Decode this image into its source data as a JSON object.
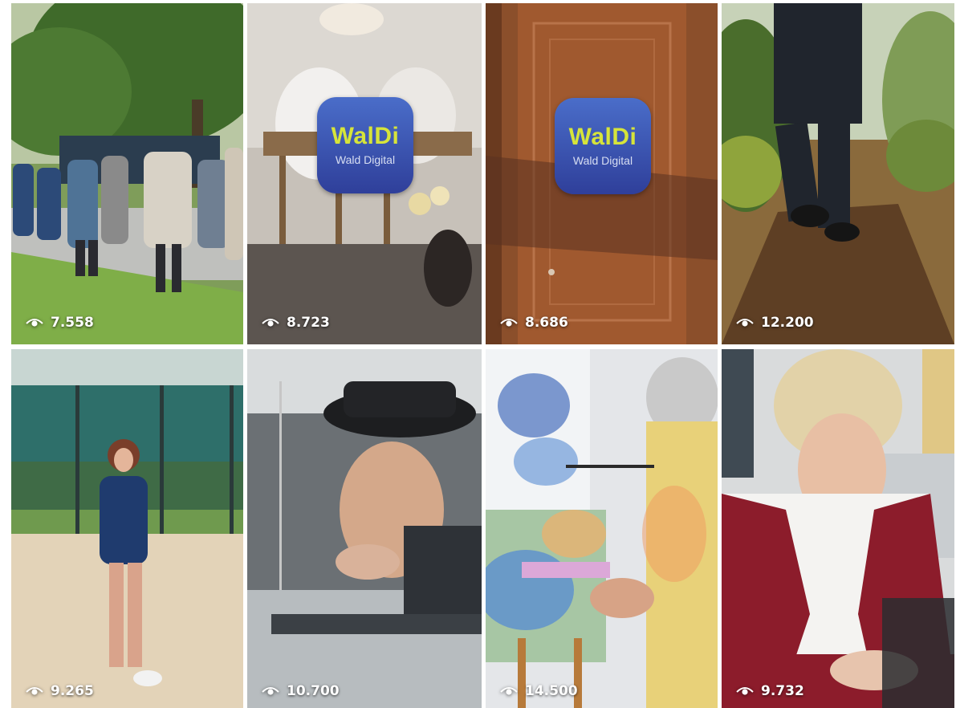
{
  "grid": {
    "tiles": [
      {
        "views": "7.558",
        "scene": "group of people walking on a path under a large tree",
        "logo": null
      },
      {
        "views": "8.723",
        "scene": "blurred people at a dining table, vase with flowers",
        "logo": {
          "word": "WalDi",
          "sub": "Wald Digital"
        }
      },
      {
        "views": "8.686",
        "scene": "wooden door in warm light",
        "logo": {
          "word": "WalDi",
          "sub": "Wald Digital"
        }
      },
      {
        "views": "12.200",
        "scene": "person walking on a forest path",
        "logo": null
      },
      {
        "views": "9.265",
        "scene": "woman in blue jacket walking on sand near a sports field fence",
        "logo": null
      },
      {
        "views": "10.700",
        "scene": "man in hat looking out of car window",
        "logo": null
      },
      {
        "views": "14.500",
        "scene": "artist painting watercolor on an easel",
        "logo": null
      },
      {
        "views": "9.732",
        "scene": "blond woman in red dirndl working at desk",
        "logo": null
      }
    ]
  },
  "colors": {
    "logo_word": "#d6e43a",
    "logo_bg": "#3a52b0",
    "overlay_text": "#ffffff"
  },
  "icons": {
    "views": "eye-icon"
  }
}
